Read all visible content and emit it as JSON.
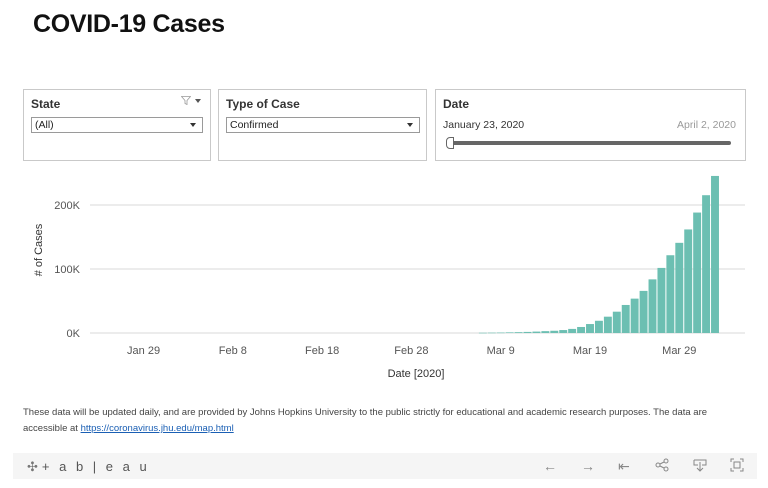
{
  "page": {
    "title": "COVID-19 Cases"
  },
  "filters": {
    "state": {
      "label": "State",
      "value": "(All)"
    },
    "type_of_case": {
      "label": "Type of Case",
      "value": "Confirmed"
    },
    "date": {
      "label": "Date",
      "start": "January 23, 2020",
      "end": "April 2, 2020"
    }
  },
  "chart_data": {
    "type": "bar",
    "xlabel": "Date [2020]",
    "ylabel": "# of Cases",
    "x_range": [
      "2020-01-23",
      "2020-04-02"
    ],
    "ylim": [
      0,
      250000
    ],
    "y_ticks": [
      0,
      100000,
      200000
    ],
    "y_tick_labels": [
      "0K",
      "100K",
      "200K"
    ],
    "x_ticks": [
      "2020-01-29",
      "2020-02-08",
      "2020-02-18",
      "2020-02-28",
      "2020-03-09",
      "2020-03-19",
      "2020-03-29"
    ],
    "x_tick_labels": [
      "Jan 29",
      "Feb 8",
      "Feb 18",
      "Feb 28",
      "Mar 9",
      "Mar 19",
      "Mar 29"
    ],
    "bar_color": "#6cbfb2",
    "grid": true,
    "dates": [
      "2020-03-07",
      "2020-03-08",
      "2020-03-09",
      "2020-03-10",
      "2020-03-11",
      "2020-03-12",
      "2020-03-13",
      "2020-03-14",
      "2020-03-15",
      "2020-03-16",
      "2020-03-17",
      "2020-03-18",
      "2020-03-19",
      "2020-03-20",
      "2020-03-21",
      "2020-03-22",
      "2020-03-23",
      "2020-03-24",
      "2020-03-25",
      "2020-03-26",
      "2020-03-27",
      "2020-03-28",
      "2020-03-29",
      "2020-03-30",
      "2020-03-31",
      "2020-04-01",
      "2020-04-02"
    ],
    "values": [
      400,
      550,
      700,
      1000,
      1300,
      1700,
      2200,
      2900,
      3500,
      4600,
      6400,
      9400,
      14000,
      19100,
      25500,
      33300,
      43800,
      53700,
      65800,
      83800,
      101700,
      121500,
      140900,
      161800,
      188200,
      215300,
      245400
    ]
  },
  "footnote": {
    "text": "These data will be updated daily, and are provided by Johns Hopkins University to the public strictly for educational and academic research purposes. The data are accessible at ",
    "link_text": "https://coronavirus.jhu.edu/map.html"
  },
  "footer": {
    "logo_text": "+ a b | e a u",
    "logo_icon": "tableau-mark-icon",
    "icons": {
      "back": "←",
      "forward": "→",
      "revert": "⇤",
      "share": "share-icon",
      "download": "download-icon",
      "fullscreen": "fullscreen-icon"
    }
  }
}
